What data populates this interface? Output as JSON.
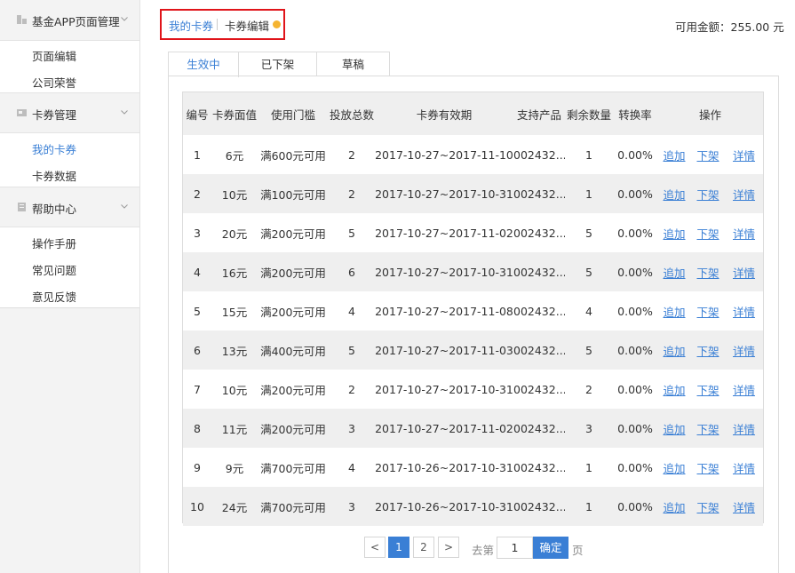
{
  "sidebar": {
    "groups": [
      {
        "title": "基金APP页面管理",
        "icon": "document-icon",
        "items": [
          "页面编辑",
          "公司荣誉"
        ]
      },
      {
        "title": "卡券管理",
        "icon": "card-icon",
        "items": [
          "我的卡券",
          "卡券数据"
        ]
      },
      {
        "title": "帮助中心",
        "icon": "help-book-icon",
        "items": [
          "操作手册",
          "常见问题",
          "意见反馈"
        ]
      }
    ],
    "active_item": "我的卡券"
  },
  "breadcrumb": {
    "link": "我的卡券",
    "current": "卡券编辑"
  },
  "balance": "可用金额：255.00 元",
  "tabs": [
    "生效中",
    "已下架",
    "草稿"
  ],
  "table": {
    "headers": [
      "编号",
      "卡券面值",
      "使用门槛",
      "投放总数",
      "卡券有效期",
      "支持产品",
      "剩余数量",
      "转换率",
      "操作"
    ],
    "actions": [
      "追加",
      "下架",
      "详情"
    ],
    "rows": [
      [
        "1",
        "6元",
        "满600元可用",
        "2",
        "2017-10-27~2017-11-10",
        "002432...",
        "1",
        "0.00%"
      ],
      [
        "2",
        "10元",
        "满100元可用",
        "2",
        "2017-10-27~2017-10-31",
        "002432...",
        "1",
        "0.00%"
      ],
      [
        "3",
        "20元",
        "满200元可用",
        "5",
        "2017-10-27~2017-11-02",
        "002432...",
        "5",
        "0.00%"
      ],
      [
        "4",
        "16元",
        "满200元可用",
        "6",
        "2017-10-27~2017-10-31",
        "002432...",
        "5",
        "0.00%"
      ],
      [
        "5",
        "15元",
        "满200元可用",
        "4",
        "2017-10-27~2017-11-08",
        "002432...",
        "4",
        "0.00%"
      ],
      [
        "6",
        "13元",
        "满400元可用",
        "5",
        "2017-10-27~2017-11-03",
        "002432...",
        "5",
        "0.00%"
      ],
      [
        "7",
        "10元",
        "满200元可用",
        "2",
        "2017-10-27~2017-10-31",
        "002432...",
        "2",
        "0.00%"
      ],
      [
        "8",
        "11元",
        "满200元可用",
        "3",
        "2017-10-27~2017-11-02",
        "002432...",
        "3",
        "0.00%"
      ],
      [
        "9",
        "9元",
        "满700元可用",
        "4",
        "2017-10-26~2017-10-31",
        "002432...",
        "1",
        "0.00%"
      ],
      [
        "10",
        "24元",
        "满700元可用",
        "3",
        "2017-10-26~2017-10-31",
        "002432...",
        "1",
        "0.00%"
      ]
    ]
  },
  "pagination": {
    "prev": "<",
    "pages": [
      "1",
      "2"
    ],
    "current": "1",
    "next": ">",
    "goto_prefix": "去第",
    "goto_value": "1",
    "goto_suffix": "页",
    "confirm": "确定"
  },
  "colors": {
    "accent": "#3a7fd5",
    "highlight_border": "#e0141a",
    "notice_dot": "#f5b431"
  }
}
